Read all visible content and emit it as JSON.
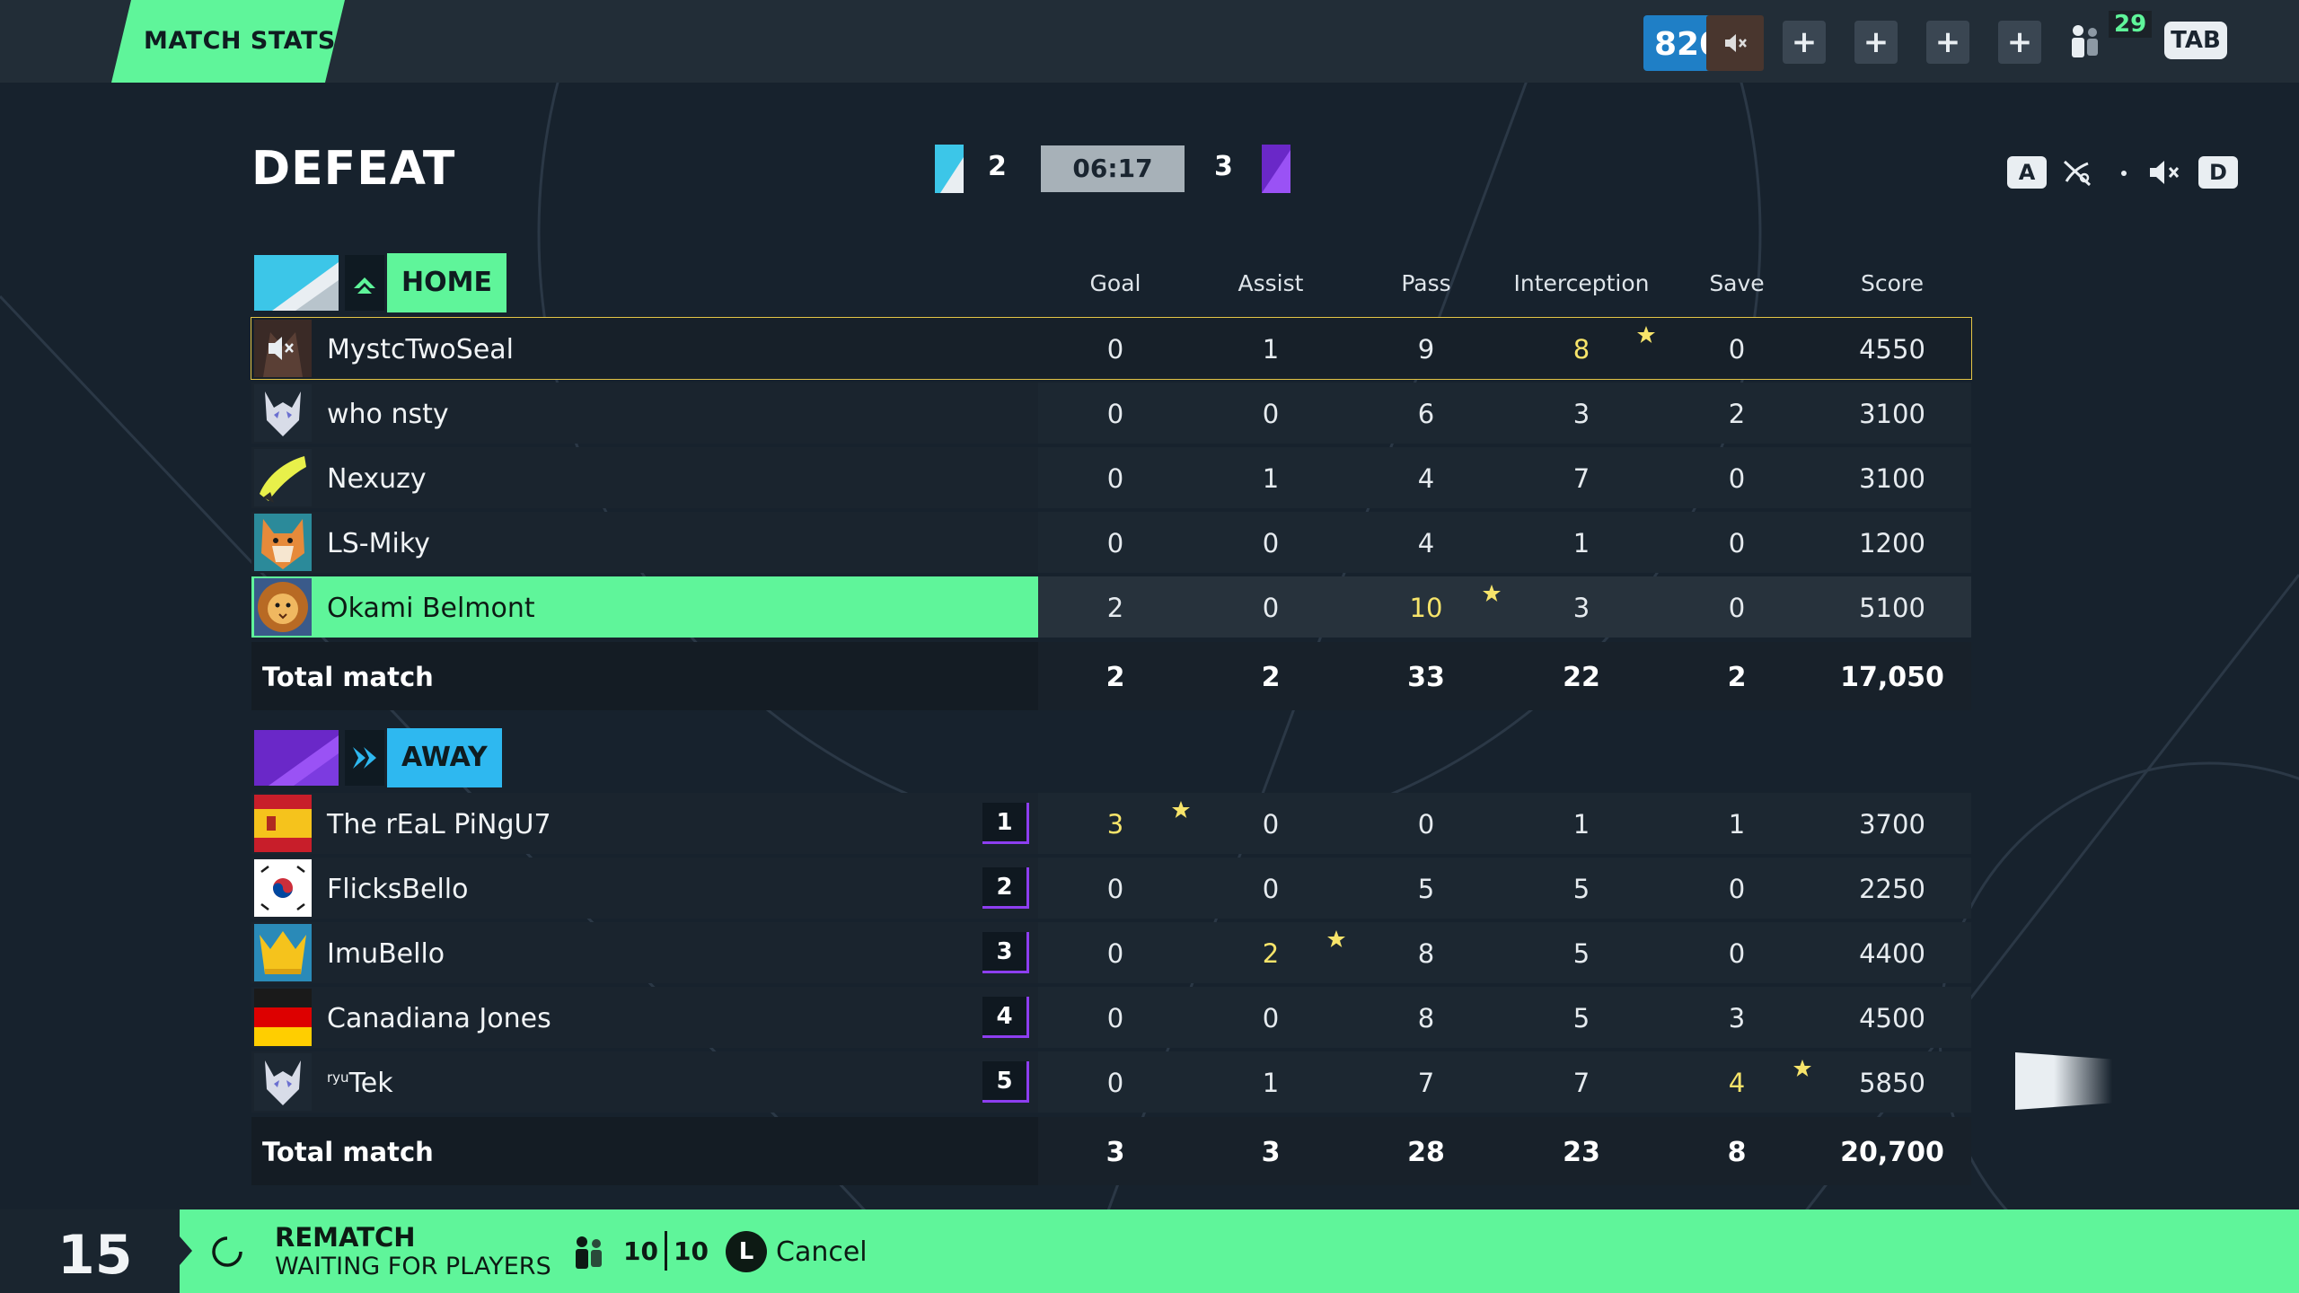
{
  "topbar": {
    "tab_label": "MATCH STATS",
    "currency": "820",
    "party_count": "29",
    "tab_key": "TAB"
  },
  "header": {
    "result": "DEFEAT",
    "home_score": "2",
    "away_score": "3",
    "timer": "06:17",
    "key_left": "A",
    "key_right": "D"
  },
  "columns": [
    "Goal",
    "Assist",
    "Pass",
    "Interception",
    "Save",
    "Score"
  ],
  "home": {
    "label": "HOME",
    "players": [
      {
        "name": "MystcTwoSeal",
        "stats": [
          "0",
          "1",
          "9",
          "8",
          "0",
          "4550"
        ]
      },
      {
        "name": "who nsty",
        "stats": [
          "0",
          "0",
          "6",
          "3",
          "2",
          "3100"
        ]
      },
      {
        "name": "Nexuzy",
        "stats": [
          "0",
          "1",
          "4",
          "7",
          "0",
          "3100"
        ]
      },
      {
        "name": "LS-Miky",
        "stats": [
          "0",
          "0",
          "4",
          "1",
          "0",
          "1200"
        ]
      },
      {
        "name": "Okami Belmont",
        "stats": [
          "2",
          "0",
          "10",
          "3",
          "0",
          "5100"
        ]
      }
    ],
    "total_label": "Total match",
    "totals": [
      "2",
      "2",
      "33",
      "22",
      "2",
      "17,050"
    ]
  },
  "away": {
    "label": "AWAY",
    "players": [
      {
        "name": "The rEaL PiNgU7",
        "rank": "1",
        "stats": [
          "3",
          "0",
          "0",
          "1",
          "1",
          "3700"
        ]
      },
      {
        "name": "FlicksBello",
        "rank": "2",
        "stats": [
          "0",
          "0",
          "5",
          "5",
          "0",
          "2250"
        ]
      },
      {
        "name": "ImuBello",
        "rank": "3",
        "stats": [
          "0",
          "2",
          "8",
          "5",
          "0",
          "4400"
        ]
      },
      {
        "name": "Canadiana Jones",
        "rank": "4",
        "stats": [
          "0",
          "0",
          "8",
          "5",
          "3",
          "4500"
        ]
      },
      {
        "name_prefix": "ryu",
        "name": "Tek",
        "rank": "5",
        "stats": [
          "0",
          "1",
          "7",
          "7",
          "4",
          "5850"
        ]
      }
    ],
    "total_label": "Total match",
    "totals": [
      "3",
      "3",
      "28",
      "23",
      "8",
      "20,700"
    ]
  },
  "bottom": {
    "countdown": "15",
    "rematch_title": "REMATCH",
    "rematch_sub": "WAITING FOR PLAYERS",
    "ready_count": "10",
    "total_count": "10",
    "cancel_key": "L",
    "cancel_label": "Cancel"
  },
  "colors": {
    "accent_green": "#5ff59a",
    "home_cyan": "#3cc6e8",
    "away_purple": "#8d3ef0",
    "highlight_gold": "#e4c545",
    "best_yellow": "#f7e46a",
    "background": "#17222d"
  },
  "icons": {
    "muted": "speaker-muted-icon",
    "party": "party-members-icon",
    "plus": "plus-icon",
    "star": "star-icon",
    "spinner": "loading-spinner-icon"
  }
}
